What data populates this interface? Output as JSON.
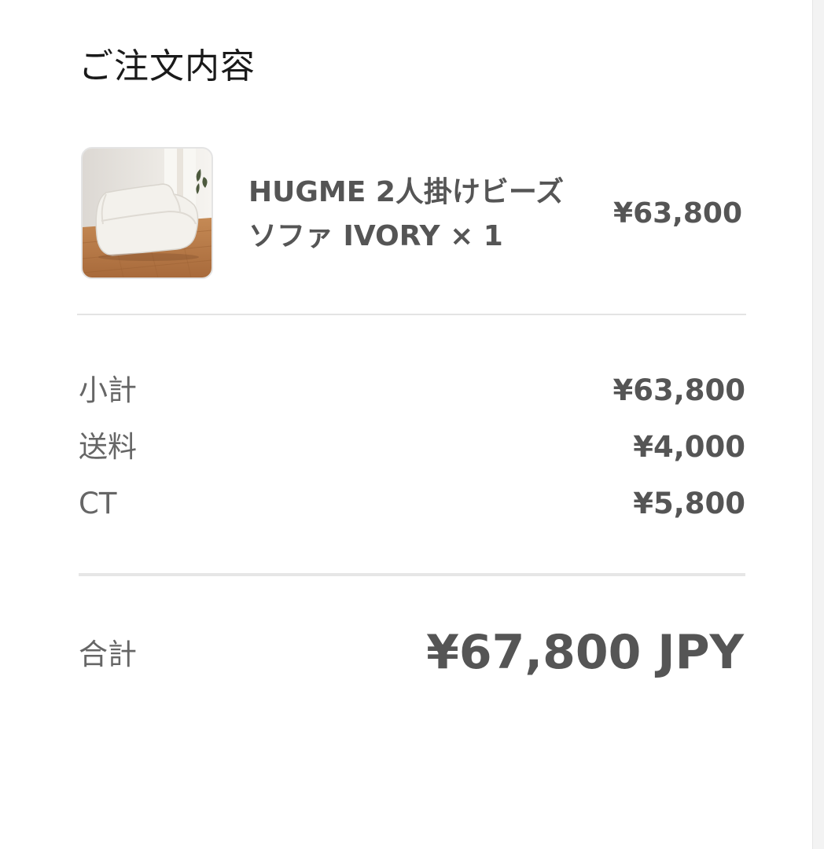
{
  "order_summary": {
    "title": "ご注文内容",
    "item": {
      "image_alt": "sofa",
      "name": "HUGME 2人掛けビーズソファ IVORY × 1",
      "price": "¥63,800"
    },
    "lines": [
      {
        "label": "小計",
        "value": "¥63,800"
      },
      {
        "label": "送料",
        "value": "¥4,000"
      },
      {
        "label": "CT",
        "value": "¥5,800"
      }
    ],
    "total": {
      "label": "合計",
      "value": "¥67,800 JPY"
    }
  },
  "colors": {
    "background": "#ffffff",
    "text_dark": "#1a1a1a",
    "text_value": "#555555",
    "text_label": "#666666",
    "divider": "#e4e4e4"
  }
}
